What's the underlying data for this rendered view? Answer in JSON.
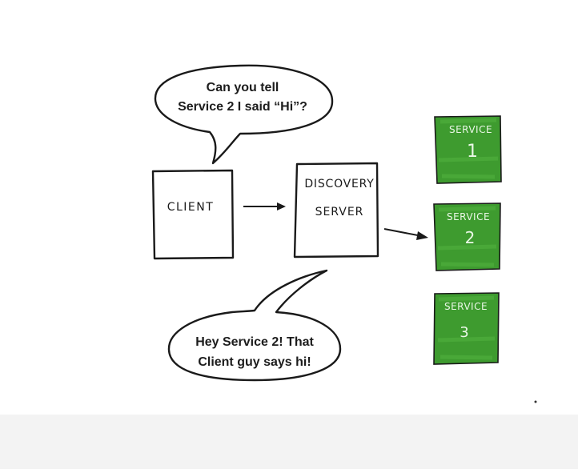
{
  "bubbles": {
    "client_question": {
      "line1": "Can you tell",
      "line2": "Service 2 I said “Hi”?"
    },
    "server_reply": {
      "line1": "Hey Service 2!  That",
      "line2": "Client guy says hi!"
    }
  },
  "nodes": {
    "client": {
      "label": "CLIENT"
    },
    "discovery_server": {
      "line1": "DISCOVERY",
      "line2": "SERVER"
    }
  },
  "services": [
    {
      "name": "SERVICE",
      "number": "1"
    },
    {
      "name": "SERVICE",
      "number": "2"
    },
    {
      "name": "SERVICE",
      "number": "3"
    }
  ],
  "colors": {
    "service_fill": "#3e9b2f",
    "service_fill_light": "#4fae3c",
    "ink": "#1a1a1a",
    "service_text": "#eaf7e6"
  }
}
